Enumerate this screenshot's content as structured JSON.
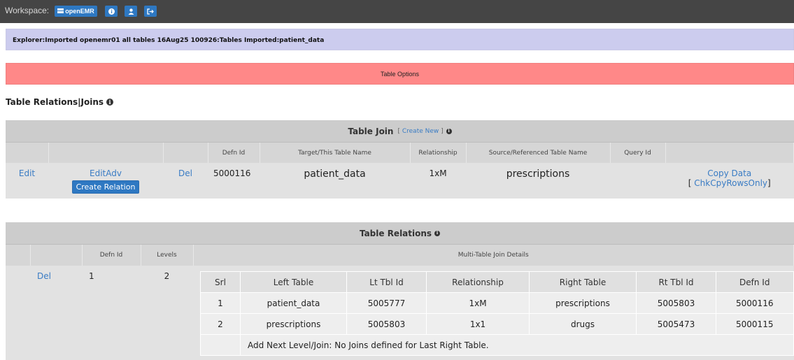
{
  "topbar": {
    "workspace_label": "Workspace:",
    "workspace_button": "openEMR",
    "icons": [
      "info-icon",
      "user-icon",
      "logout-icon"
    ]
  },
  "explorer": {
    "text": "Explorer:Imported openemr01 all tables 16Aug25 100926:Tables Imported:patient_data"
  },
  "options": {
    "label": "Table Options"
  },
  "section": {
    "title": "Table Relations|Joins"
  },
  "join_panel": {
    "title": "Table Join",
    "create_new_open": "[",
    "create_new": "Create New",
    "create_new_close": "]",
    "headers": [
      "",
      "",
      "",
      "Defn Id",
      "Target/This Table Name",
      "Relationship",
      "Source/Referenced Table Name",
      "Query Id",
      ""
    ],
    "row": {
      "edit": "Edit",
      "edit_adv": "EditAdv",
      "create_relation": "Create Relation",
      "del": "Del",
      "defn_id": "5000116",
      "target": "patient_data",
      "relationship": "1xM",
      "source": "prescriptions",
      "query_id": "",
      "copy_data": "Copy Data",
      "chk_open": "[",
      "chk_copy": "ChkCpyRowsOnly",
      "chk_close": "]"
    }
  },
  "relations_panel": {
    "title": "Table Relations",
    "headers": [
      "",
      "",
      "Defn Id",
      "Levels",
      "Multi-Table Join Details"
    ],
    "row": {
      "del": "Del",
      "defn_id": "1",
      "levels": "2"
    },
    "inner_headers": [
      "Srl",
      "Left Table",
      "Lt Tbl Id",
      "Relationship",
      "Right Table",
      "Rt Tbl Id",
      "Defn Id"
    ],
    "inner_rows": [
      [
        "1",
        "patient_data",
        "5005777",
        "1xM",
        "prescriptions",
        "5005803",
        "5000116"
      ],
      [
        "2",
        "prescriptions",
        "5005803",
        "1x1",
        "drugs",
        "5005473",
        "5000115"
      ]
    ],
    "footer_note": "Add Next Level/Join: No Joins defined for Last Right Table."
  },
  "colors": {
    "topbar": "#454545",
    "accent": "#2e78c2",
    "explorer_bg": "#ccccee",
    "options_bg": "#ff8888",
    "link": "#3a7cc4"
  }
}
